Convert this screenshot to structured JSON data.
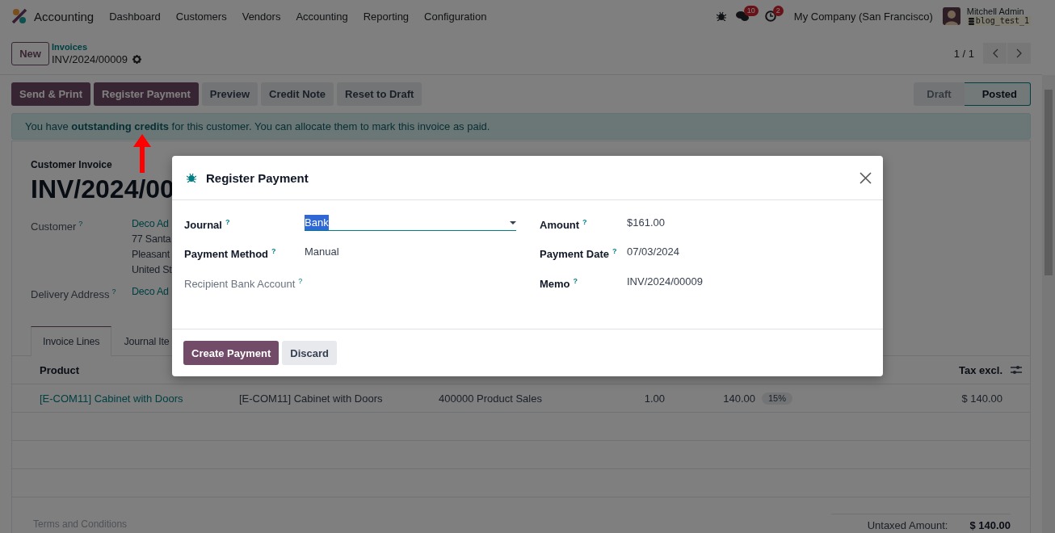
{
  "navbar": {
    "app": "Accounting",
    "menus": [
      "Dashboard",
      "Customers",
      "Vendors",
      "Accounting",
      "Reporting",
      "Configuration"
    ],
    "messages_count": "10",
    "activities_count": "2",
    "company": "My Company (San Francisco)",
    "user": "Mitchell Admin",
    "database": "blog_test_1"
  },
  "control_panel": {
    "new_button": "New",
    "breadcrumb": "Invoices",
    "record": "INV/2024/00009",
    "pager": "1 / 1"
  },
  "actions": [
    {
      "label": "Send & Print",
      "kind": "primary"
    },
    {
      "label": "Register Payment",
      "kind": "primary"
    },
    {
      "label": "Preview",
      "kind": "secondary"
    },
    {
      "label": "Credit Note",
      "kind": "secondary"
    },
    {
      "label": "Reset to Draft",
      "kind": "secondary"
    }
  ],
  "status_steps": [
    {
      "label": "Draft",
      "selected": false
    },
    {
      "label": "Posted",
      "selected": true
    }
  ],
  "alert": "You have **outstanding credits** for this customer. You can allocate them to mark this invoice as paid.",
  "form": {
    "type": "Customer Invoice",
    "name": "INV/2024/00",
    "fields": [
      {
        "label": "Customer",
        "help": "?",
        "lines": [
          "Deco Ad",
          "77 Santa",
          "Pleasant",
          "United St"
        ]
      },
      {
        "label": "Delivery Address",
        "help": "?",
        "lines": [
          "Deco Ad"
        ]
      }
    ],
    "tabs": [
      {
        "label": "Invoice Lines",
        "selected": true
      },
      {
        "label": "Journal Ite",
        "selected": false
      }
    ],
    "table": {
      "columns": [
        "Product",
        "Tax excl."
      ],
      "rows": [
        {
          "product": "[E-COM11] Cabinet with Doors",
          "label": "[E-COM11] Cabinet with Doors",
          "account": "400000 Product Sales",
          "quantity": "1.00",
          "price": "140.00",
          "tax": "15%",
          "subtotal": "$ 140.00"
        }
      ]
    },
    "terms_placeholder": "Terms and Conditions",
    "totals": [
      {
        "label": "Untaxed Amount:",
        "value": "$ 140.00"
      }
    ]
  },
  "dialog": {
    "title": "Register Payment",
    "left_fields": [
      {
        "label": "Journal",
        "help": "?",
        "kind": "select",
        "value": "Bank",
        "disabled": false,
        "value_selected": true
      },
      {
        "label": "Payment Method",
        "help": "?",
        "kind": "text",
        "value": "Manual",
        "disabled": false
      },
      {
        "label": "Recipient Bank Account",
        "help": "?",
        "kind": "empty",
        "disabled": true
      }
    ],
    "right_fields": [
      {
        "label": "Amount",
        "help": "?",
        "kind": "text",
        "value": "$161.00",
        "disabled": false
      },
      {
        "label": "Payment Date",
        "help": "?",
        "kind": "text",
        "value": "07/03/2024",
        "disabled": false
      },
      {
        "label": "Memo",
        "help": "?",
        "kind": "text",
        "value": "INV/2024/00009",
        "disabled": false
      }
    ],
    "buttons": [
      {
        "label": "Create Payment",
        "kind": "primary"
      },
      {
        "label": "Discard",
        "kind": "secondary"
      }
    ]
  }
}
